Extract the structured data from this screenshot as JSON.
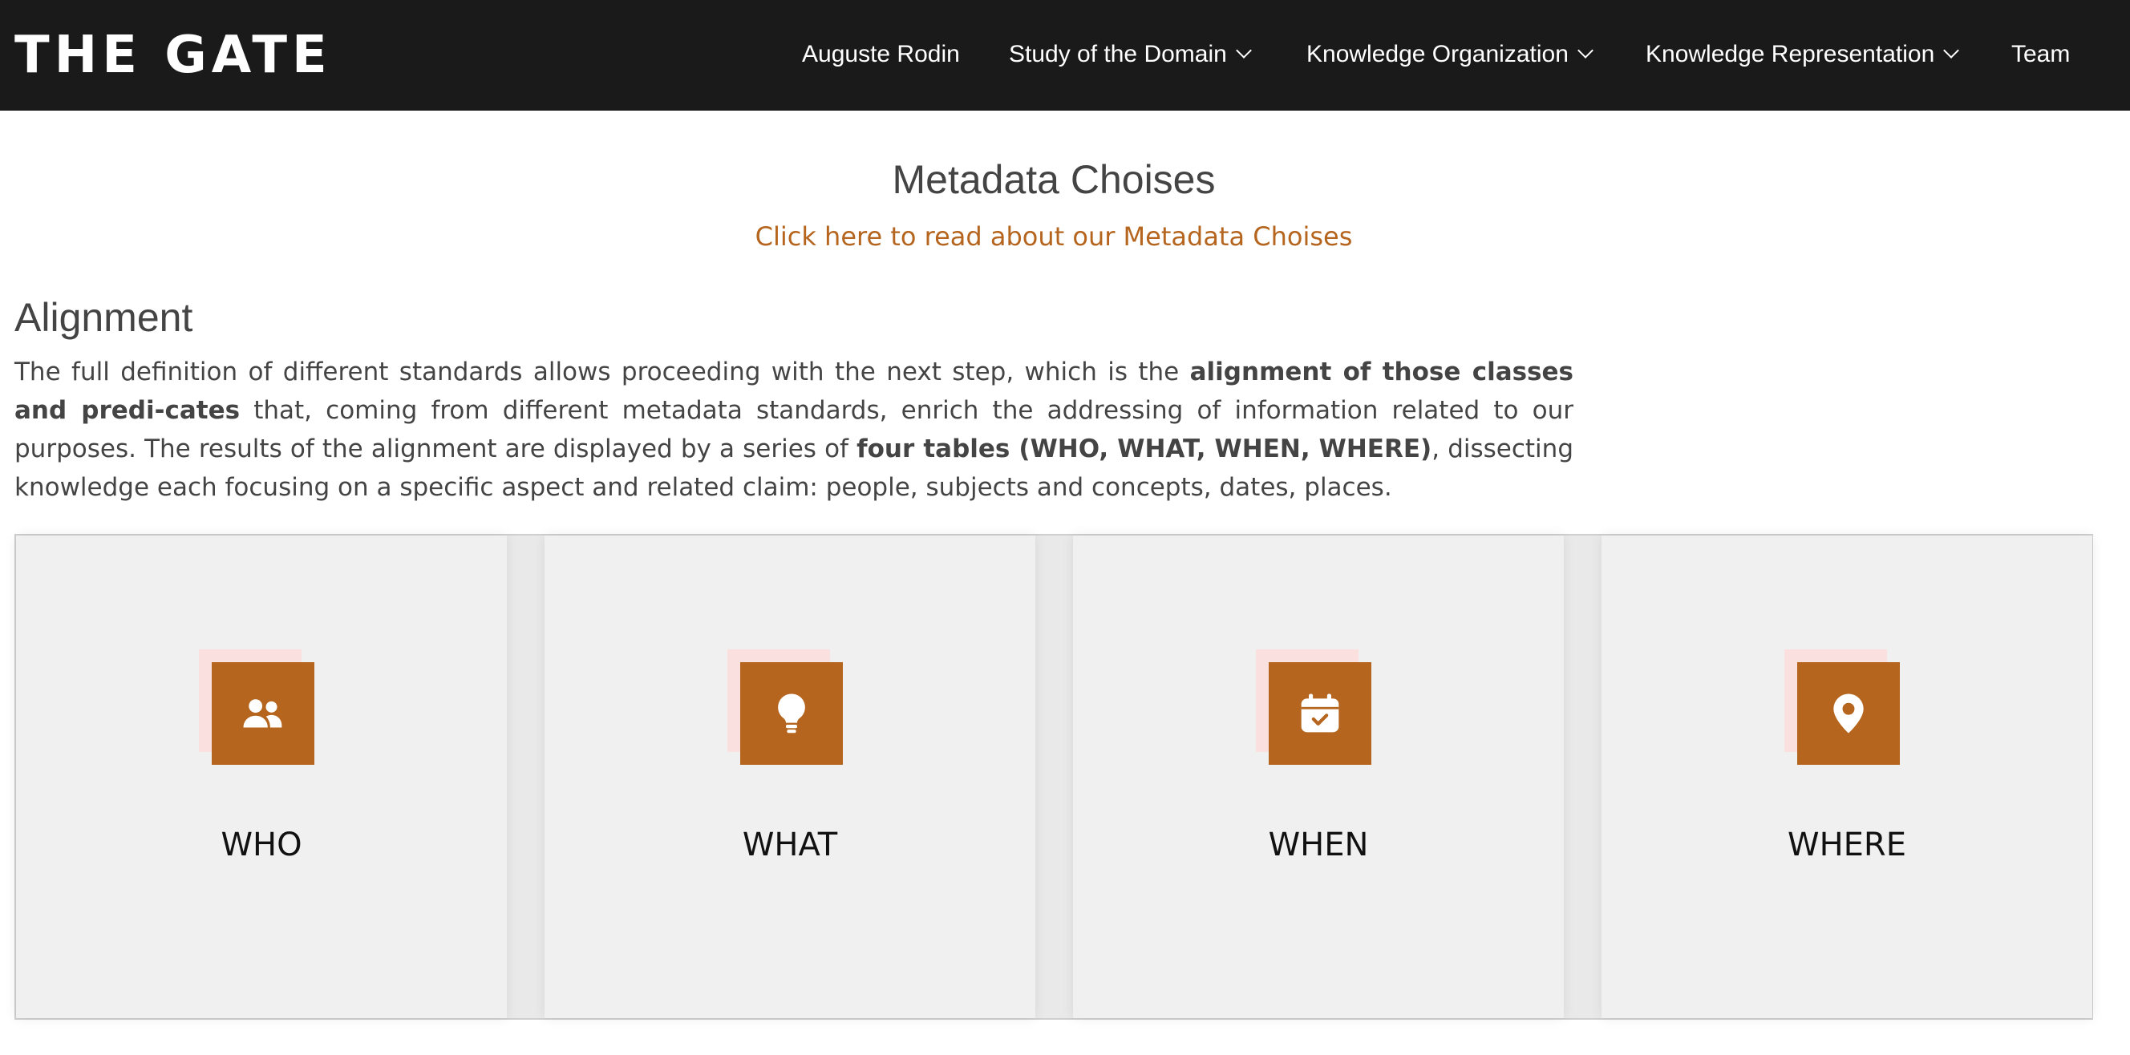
{
  "header": {
    "logo": "THE GATE",
    "nav": [
      {
        "label": "Auguste Rodin"
      },
      {
        "label": "Study of the Domain"
      },
      {
        "label": "Knowledge Organization"
      },
      {
        "label": "Knowledge Representation"
      },
      {
        "label": "Team"
      }
    ]
  },
  "metadata": {
    "title": "Metadata Choises",
    "link": "Click here to read about our Metadata Choises"
  },
  "alignment": {
    "title": "Alignment",
    "text_1": "The full definition of different standards allows proceeding with the next step, which is the ",
    "bold_1": "alignment of those classes and predi-cates",
    "text_2": " that, coming from different metadata standards, enrich the addressing of information related to our purposes. The results of the alignment are displayed by a series of ",
    "bold_2": "four tables (WHO, WHAT, WHEN, WHERE)",
    "text_3": ", dissecting knowledge each focusing on a specific aspect and related claim: people, subjects and concepts, dates, places."
  },
  "cards": [
    {
      "label": "WHO",
      "icon": "people-icon"
    },
    {
      "label": "WHAT",
      "icon": "lightbulb-icon"
    },
    {
      "label": "WHEN",
      "icon": "calendar-check-icon"
    },
    {
      "label": "WHERE",
      "icon": "map-pin-icon"
    }
  ],
  "colors": {
    "header_bg": "#1a1a1a",
    "accent": "#b5651d",
    "card_bg": "#f0f0f0"
  }
}
